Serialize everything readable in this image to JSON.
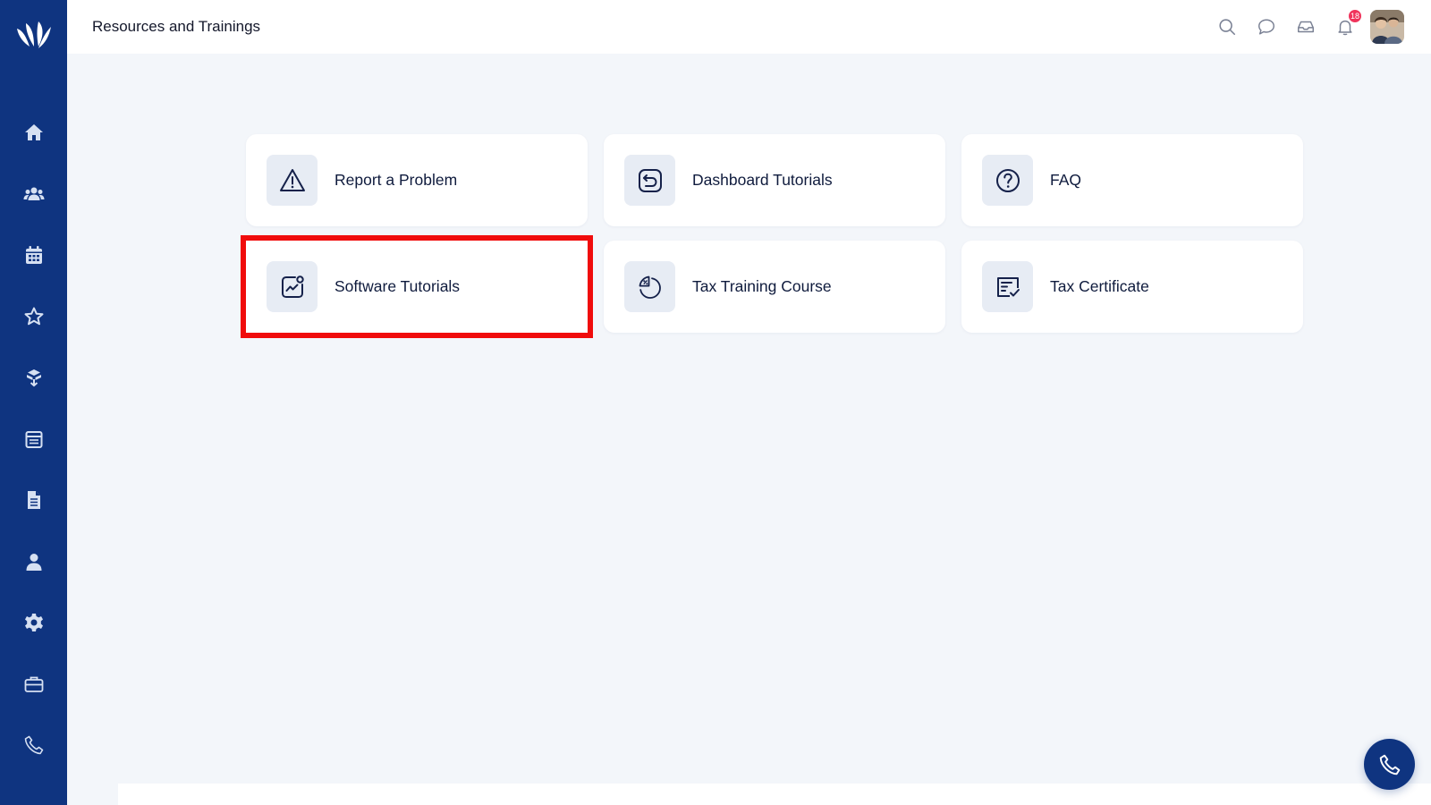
{
  "header": {
    "title": "Resources and Trainings",
    "notification_count": "18"
  },
  "sidebar": {
    "items": [
      {
        "icon": "home-icon"
      },
      {
        "icon": "users-icon"
      },
      {
        "icon": "calendar-icon"
      },
      {
        "icon": "star-icon"
      },
      {
        "icon": "network-icon"
      },
      {
        "icon": "schedule-icon"
      },
      {
        "icon": "document-icon"
      },
      {
        "icon": "user-icon"
      },
      {
        "icon": "gear-icon"
      },
      {
        "icon": "briefcase-icon"
      },
      {
        "icon": "phone-icon"
      }
    ]
  },
  "cards": [
    {
      "label": "Report a Problem",
      "icon": "warning-icon"
    },
    {
      "label": "Dashboard Tutorials",
      "icon": "return-arrow-icon"
    },
    {
      "label": "FAQ",
      "icon": "question-icon"
    },
    {
      "label": "Software Tutorials",
      "icon": "chart-gear-icon",
      "highlighted": true
    },
    {
      "label": "Tax Training Course",
      "icon": "percent-pie-icon"
    },
    {
      "label": "Tax Certificate",
      "icon": "certificate-icon"
    }
  ],
  "colors": {
    "sidebar": "#0f3480",
    "highlight": "#f00c0c",
    "badge": "#f0335b",
    "background": "#f3f6fa"
  }
}
